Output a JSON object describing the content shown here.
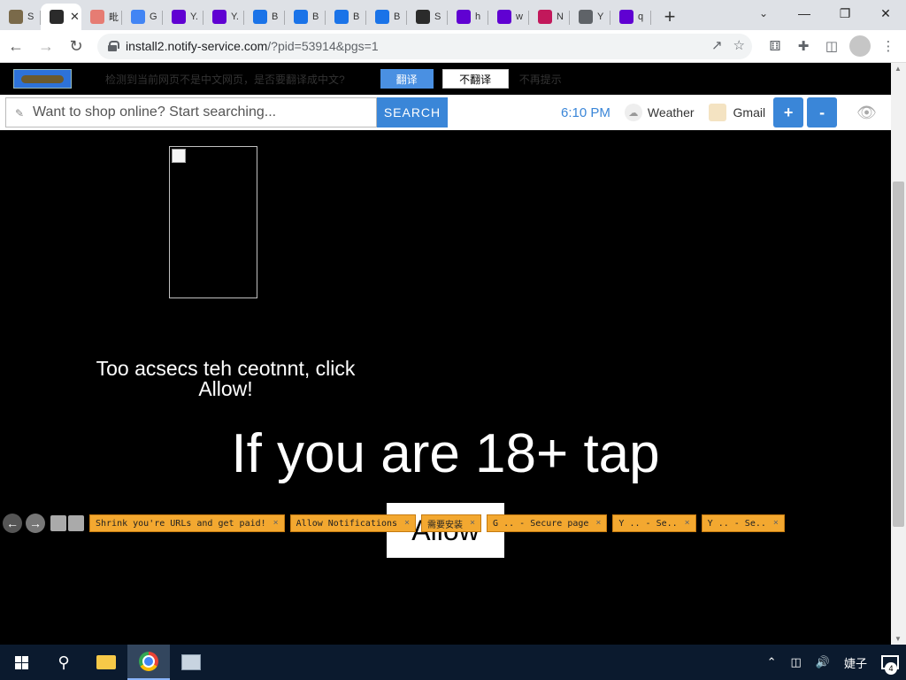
{
  "browser": {
    "tabs": [
      {
        "title": "S",
        "icon": "notify-favicon",
        "color": "#7a6a4a"
      },
      {
        "title": "",
        "icon": "cube-favicon",
        "color": "#2b2b2b",
        "active": true
      },
      {
        "title": "毗",
        "icon": "rainbow-favicon",
        "color": "#e67c73"
      },
      {
        "title": "G",
        "icon": "google-favicon",
        "color": "#4285f4"
      },
      {
        "title": "Y.",
        "icon": "yahoo-favicon",
        "color": "#6001d2"
      },
      {
        "title": "Y.",
        "icon": "yahoo-favicon",
        "color": "#6001d2"
      },
      {
        "title": "B",
        "icon": "s-favicon",
        "color": "#1a73e8"
      },
      {
        "title": "B",
        "icon": "s-favicon",
        "color": "#1a73e8"
      },
      {
        "title": "B",
        "icon": "s-favicon",
        "color": "#1a73e8"
      },
      {
        "title": "B",
        "icon": "s-favicon",
        "color": "#1a73e8"
      },
      {
        "title": "S",
        "icon": "cube-favicon",
        "color": "#2b2b2b"
      },
      {
        "title": "h",
        "icon": "yahoo-favicon",
        "color": "#6001d2"
      },
      {
        "title": "w",
        "icon": "yahoo-favicon",
        "color": "#6001d2"
      },
      {
        "title": "N",
        "icon": "pink-circle-favicon",
        "color": "#c2185b"
      },
      {
        "title": "Y",
        "icon": "globe-favicon",
        "color": "#5f6368"
      },
      {
        "title": "q",
        "icon": "yahoo-favicon",
        "color": "#6001d2"
      }
    ],
    "url_host": "install2.notify-service.com",
    "url_path": "/?pid=53914&pgs=1"
  },
  "translate_bar": {
    "message": "检测到当前网页不是中文网页，是否要翻译成中文?",
    "translate_label": "翻译",
    "no_translate_label": "不翻译",
    "never_label": "不再提示"
  },
  "ext_bar": {
    "search_placeholder": "Want to shop online? Start searching...",
    "search_button": "SEARCH",
    "time": "6:10 PM",
    "weather_label": "Weather",
    "gmail_label": "Gmail",
    "plus_label": "+",
    "minus_label": "-"
  },
  "content": {
    "access_message": "Too acsecs teh ceotnnt, click Allow!",
    "age_message": "If you are 18+ tap",
    "allow_button": "Allow"
  },
  "bottom_tabs": [
    {
      "label": "Shrink you're URLs and get paid!"
    },
    {
      "label": "Allow Notifications"
    },
    {
      "label": "需要安装"
    },
    {
      "label": "G .. - Secure page"
    },
    {
      "label": "Y .. - Se.."
    },
    {
      "label": "Y .. - Se.."
    }
  ],
  "taskbar": {
    "ime_label": "婕子",
    "notification_count": "4"
  }
}
